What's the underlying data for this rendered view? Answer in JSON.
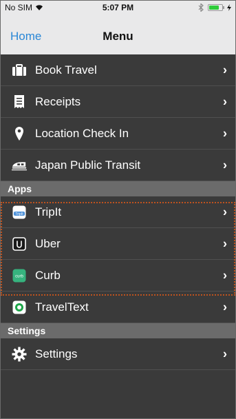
{
  "status_bar": {
    "carrier": "No SIM",
    "time": "5:07 PM"
  },
  "nav": {
    "back_label": "Home",
    "title": "Menu"
  },
  "main_items": [
    {
      "label": "Book Travel",
      "icon": "briefcase-icon"
    },
    {
      "label": "Receipts",
      "icon": "receipt-icon"
    },
    {
      "label": "Location Check In",
      "icon": "location-pin-icon"
    },
    {
      "label": "Japan Public Transit",
      "icon": "train-icon"
    }
  ],
  "sections": {
    "apps": "Apps",
    "settings": "Settings"
  },
  "apps": [
    {
      "label": "TripIt",
      "icon": "tripit-icon"
    },
    {
      "label": "Uber",
      "icon": "uber-icon"
    },
    {
      "label": "Curb",
      "icon": "curb-icon"
    },
    {
      "label": "TravelText",
      "icon": "traveltext-icon"
    }
  ],
  "settings_items": [
    {
      "label": "Settings",
      "icon": "gear-icon"
    }
  ],
  "chevron": "›",
  "colors": {
    "accent": "#2a87d6",
    "row_bg": "#3a3a3a",
    "section_bg": "#6b6b6b",
    "highlight": "#c0531e"
  }
}
